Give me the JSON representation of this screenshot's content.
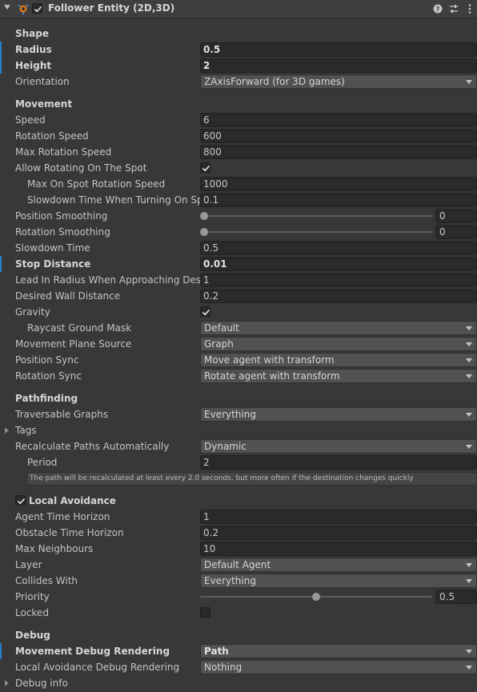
{
  "header": {
    "title": "Follower Entity (2D,3D)",
    "enabled": true
  },
  "sections": {
    "shape": "Shape",
    "movement": "Movement",
    "pathfinding": "Pathfinding",
    "local_avoidance": "Local Avoidance",
    "debug": "Debug"
  },
  "shape": {
    "radius": {
      "label": "Radius",
      "value": "0.5"
    },
    "height": {
      "label": "Height",
      "value": "2"
    },
    "orientation": {
      "label": "Orientation",
      "value": "ZAxisForward (for 3D games)"
    }
  },
  "movement": {
    "speed": {
      "label": "Speed",
      "value": "6"
    },
    "rotation_speed": {
      "label": "Rotation Speed",
      "value": "600"
    },
    "max_rotation_speed": {
      "label": "Max Rotation Speed",
      "value": "800"
    },
    "allow_rotating": {
      "label": "Allow Rotating On The Spot",
      "checked": true
    },
    "max_on_spot": {
      "label": "Max On Spot Rotation Speed",
      "value": "1000"
    },
    "slowdown_turning": {
      "label": "Slowdown Time When Turning On Spot",
      "value": "0.1"
    },
    "position_smoothing": {
      "label": "Position Smoothing",
      "value": "0",
      "level": 0
    },
    "rotation_smoothing": {
      "label": "Rotation Smoothing",
      "value": "0",
      "level": 0
    },
    "slowdown_time": {
      "label": "Slowdown Time",
      "value": "0.5"
    },
    "stop_distance": {
      "label": "Stop Distance",
      "value": "0.01"
    },
    "lead_in_radius": {
      "label": "Lead In Radius When Approaching Destination",
      "value": "1"
    },
    "desired_wall": {
      "label": "Desired Wall Distance",
      "value": "0.2"
    },
    "gravity": {
      "label": "Gravity",
      "checked": true
    },
    "raycast_mask": {
      "label": "Raycast Ground Mask",
      "value": "Default"
    },
    "plane_source": {
      "label": "Movement Plane Source",
      "value": "Graph"
    },
    "position_sync": {
      "label": "Position Sync",
      "value": "Move agent with transform"
    },
    "rotation_sync": {
      "label": "Rotation Sync",
      "value": "Rotate agent with transform"
    }
  },
  "pathfinding": {
    "traversable": {
      "label": "Traversable Graphs",
      "value": "Everything"
    },
    "tags": {
      "label": "Tags"
    },
    "recalculate": {
      "label": "Recalculate Paths Automatically",
      "value": "Dynamic"
    },
    "period": {
      "label": "Period",
      "value": "2"
    },
    "help": "The path will be recalculated at least every 2.0 seconds, but more often if the destination changes quickly"
  },
  "avoidance": {
    "enabled": true,
    "agent_time": {
      "label": "Agent Time Horizon",
      "value": "1"
    },
    "obstacle_time": {
      "label": "Obstacle Time Horizon",
      "value": "0.2"
    },
    "max_neighbours": {
      "label": "Max Neighbours",
      "value": "10"
    },
    "layer": {
      "label": "Layer",
      "value": "Default Agent"
    },
    "collides_with": {
      "label": "Collides With",
      "value": "Everything"
    },
    "priority": {
      "label": "Priority",
      "value": "0.5",
      "level": 0.5
    },
    "locked": {
      "label": "Locked",
      "checked": false
    }
  },
  "debug": {
    "movement_rendering": {
      "label": "Movement Debug Rendering",
      "value": "Path"
    },
    "avoidance_rendering": {
      "label": "Local Avoidance Debug Rendering",
      "value": "Nothing"
    },
    "debug_info": {
      "label": "Debug info"
    }
  },
  "icons": [
    "fold-arrow-icon",
    "follower-component-icon",
    "enabled-checkbox-icon",
    "help-icon",
    "presets-icon",
    "kebab-menu-icon",
    "dropdown-arrow-icon"
  ],
  "colors": {
    "background": "#383838",
    "field": "#2a2a2a",
    "dropdown": "#515151",
    "modified_marker": "#2b7fd0"
  }
}
